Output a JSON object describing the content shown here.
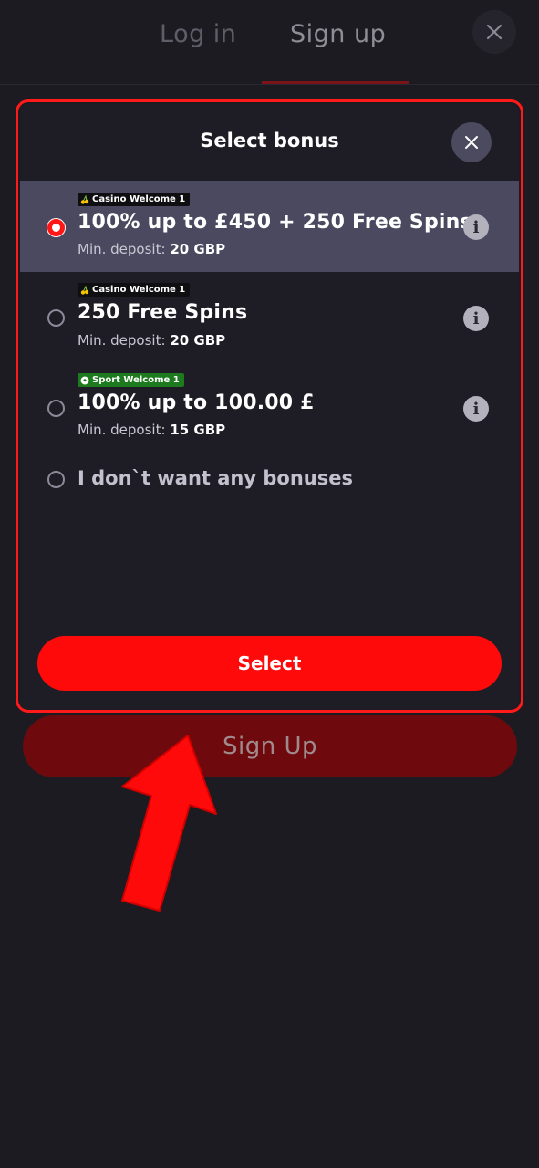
{
  "tabs": {
    "login": "Log in",
    "signup": "Sign up"
  },
  "modal": {
    "title": "Select bonus",
    "options": [
      {
        "tag": "Casino Welcome 1",
        "tag_icon": "cherries-icon",
        "title": "100% up to £450 + 250 Free Spins",
        "deposit_label": "Min. deposit:",
        "deposit_value": "20 GBP",
        "selected": true
      },
      {
        "tag": "Casino Welcome 1",
        "tag_icon": "cherries-icon",
        "title": "250 Free Spins",
        "deposit_label": "Min. deposit:",
        "deposit_value": "20 GBP",
        "selected": false
      },
      {
        "tag": "Sport Welcome 1",
        "tag_icon": "soccer-ball-icon",
        "title": "100% up to 100.00 £",
        "deposit_label": "Min. deposit:",
        "deposit_value": "15 GBP",
        "selected": false
      }
    ],
    "no_bonus": "I don`t want any bonuses",
    "select_button": "Select"
  },
  "signup_button": "Sign Up",
  "colors": {
    "background": "#1c1b22",
    "modal_bg": "#1e1d25",
    "selected_row": "#4a4960",
    "accent_red": "#ff0a0a",
    "signup_disabled": "#6e0a0e",
    "sport_tag": "#1d7a1f",
    "highlight_frame": "#ff1a1a"
  }
}
